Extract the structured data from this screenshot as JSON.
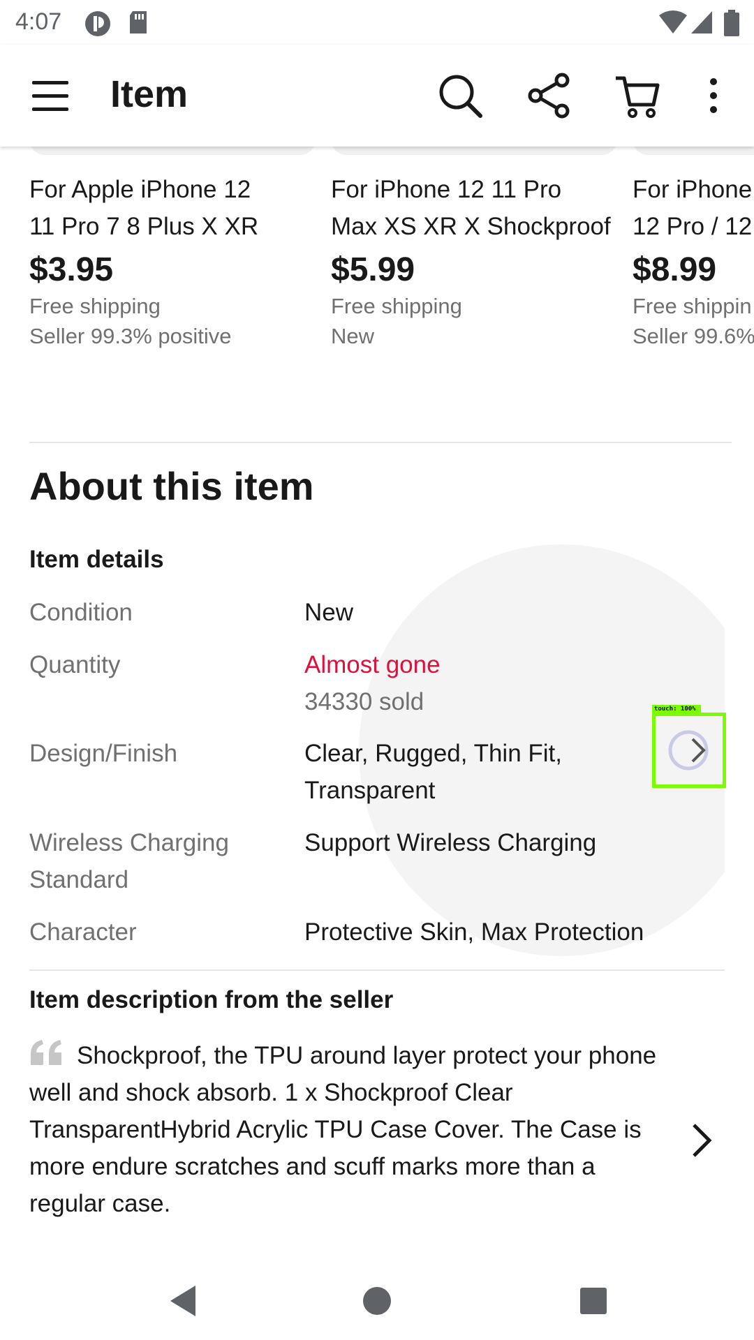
{
  "status_bar": {
    "time": "4:07"
  },
  "app_bar": {
    "title": "Item",
    "icons": [
      "menu-icon",
      "search-icon",
      "share-icon",
      "cart-icon",
      "more-vertical-icon"
    ]
  },
  "carousel": [
    {
      "title_line1": "For Apple iPhone 12",
      "title_line2": "11 Pro 7 8 Plus X XR",
      "price": "$3.95",
      "shipping": "Free shipping",
      "extra": "Seller 99.3% positive"
    },
    {
      "title_line1": "For iPhone 12 11 Pro",
      "title_line2": "Max XS XR X Shockproof",
      "price": "$5.99",
      "shipping": "Free shipping",
      "extra": "New"
    },
    {
      "title_line1": "For iPhone",
      "title_line2": "12 Pro / 12",
      "price": "$8.99",
      "shipping": "Free shippin",
      "extra": "Seller 99.6%"
    }
  ],
  "about": {
    "heading": "About this item",
    "details_heading": "Item details",
    "specs": [
      {
        "label": "Condition",
        "value": "New"
      },
      {
        "label": "Quantity",
        "value": "Almost gone",
        "value2": "34330 sold"
      },
      {
        "label": "Design/Finish",
        "value": "Clear, Rugged, Thin Fit,",
        "value2": "Transparent"
      },
      {
        "label": "Wireless Charging",
        "label2": "Standard",
        "value": "Support Wireless Charging"
      },
      {
        "label": "Character",
        "value": "Protective Skin, Max Protection"
      }
    ],
    "touch_tag": "touch: 100%"
  },
  "description": {
    "heading": "Item description from the seller",
    "text": "Shockproof, the TPU around layer protect your phone well and shock absorb. 1 x Shockproof Clear TransparentHybrid Acrylic TPU Case Cover. The Case is more endure scratches and scuff marks more than a regular case."
  },
  "colors": {
    "accent_red": "#e0103a",
    "touch_highlight": "#7cfc00"
  }
}
